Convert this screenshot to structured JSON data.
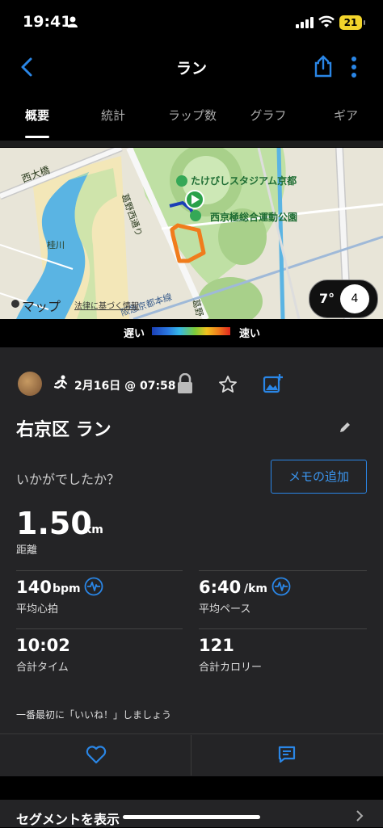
{
  "status_bar": {
    "time": "19:41",
    "battery": "21"
  },
  "header": {
    "title": "ラン"
  },
  "tabs": [
    {
      "label": "概要"
    },
    {
      "label": "統計"
    },
    {
      "label": "ラップ数"
    },
    {
      "label": "グラフ"
    },
    {
      "label": "ギア"
    }
  ],
  "map": {
    "labels": {
      "nishiohashi": "西大橋",
      "stadium": "たけびしスタジアム京都",
      "park": "西京極総合運動公園",
      "takano": "葛野西通り",
      "katsura": "桂川",
      "hankyu": "阪急京都本線",
      "takano2": "葛野",
      "apple_maps": "マップ",
      "legal": "法律に基づく情報"
    },
    "weather": {
      "temperature": "7°",
      "wind": "4"
    }
  },
  "pace_legend": {
    "slow": "遅い",
    "fast": "速い"
  },
  "activity": {
    "date": "2月16日 @ 07:58",
    "name": "右京区 ラン",
    "feel_prompt": "いかがでしたか？",
    "memo_button": "メモの追加",
    "distance": {
      "value": "1.50",
      "unit": "km",
      "label": "距離"
    },
    "avg_hr": {
      "value": "140",
      "unit": "bpm",
      "label": "平均心拍"
    },
    "avg_pace": {
      "value": "6:40",
      "unit": "/km",
      "label": "平均ペース"
    },
    "total_time": {
      "value": "10:02",
      "label": "合計タイム"
    },
    "calories": {
      "value": "121",
      "label": "合計カロリー"
    },
    "like_prompt": "一番最初に「いいね！」しましょう"
  },
  "segments": {
    "label": "セグメントを表示"
  }
}
